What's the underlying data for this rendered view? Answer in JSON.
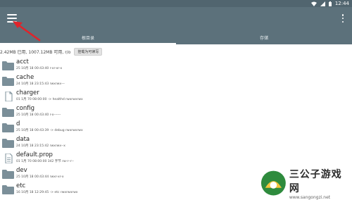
{
  "statusbar": {
    "time": "12:44",
    "icons": [
      "wifi-icon",
      "signal-icon",
      "battery-icon"
    ]
  },
  "appbar": {
    "menu_icon": "hamburger-menu-icon",
    "overflow_icon": "more-vert-icon"
  },
  "tabs": [
    {
      "label": "根目录",
      "selected": true
    },
    {
      "label": "存储",
      "selected": false
    }
  ],
  "info": {
    "text": "2.42MB 已用, 1007.12MB 可用, r/o",
    "button_label": "挂载为可读写"
  },
  "files": [
    {
      "name": "acct",
      "meta": "25 10月 18 00:43:40  r-xr-xr-x",
      "type": "folder"
    },
    {
      "name": "cache",
      "meta": "24 10月 18 23:15:43  rwxrwx---",
      "type": "folder"
    },
    {
      "name": "charger",
      "meta": "01 1月 70 08:00:00  -> healthd  rwxrwxrwx",
      "type": "file"
    },
    {
      "name": "config",
      "meta": "25 10月 18 00:43:40  r-x------",
      "type": "folder"
    },
    {
      "name": "d",
      "meta": "25 10月 18 00:43:39  -> debug  rwxrwxrwx",
      "type": "folder"
    },
    {
      "name": "data",
      "meta": "24 10月 18 23:15:42  rwxrwx--x",
      "type": "folder"
    },
    {
      "name": "default.prop",
      "meta": "01 1月 70 08:00:00  342 字节  rw-r--r--",
      "type": "doc"
    },
    {
      "name": "dev",
      "meta": "25 10月 18 00:43:44  rwxr-xr-x",
      "type": "folder"
    },
    {
      "name": "etc",
      "meta": "16 10月 18 12:29:45  -> etc  rwxrwxrwx",
      "type": "folder"
    }
  ],
  "watermark": {
    "name": "三公子游戏网",
    "url": "www.sangongzi.net"
  },
  "colors": {
    "appbar": "#5c717b",
    "statusbar": "#51656f",
    "folder": "#7b8f99",
    "arrow": "#e0242a"
  }
}
